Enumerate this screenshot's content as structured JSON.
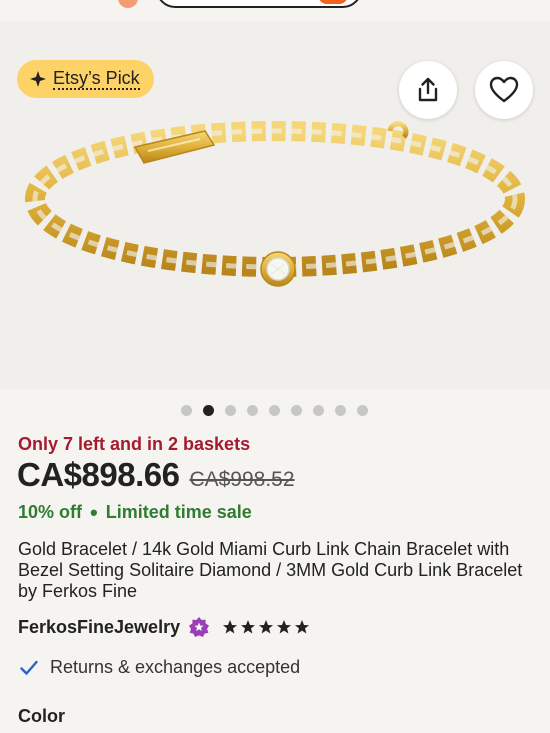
{
  "gallery": {
    "badge_label": "Etsy’s Pick",
    "image_count": 9,
    "active_index": 1
  },
  "listing": {
    "stock_text": "Only 7 left and in 2 baskets",
    "price": "CA$898.66",
    "original_price": "CA$998.52",
    "discount": "10% off",
    "sale_label": "Limited time sale",
    "title": "Gold Bracelet / 14k Gold Miami Curb Link Chain Bracelet with Bezel Setting Solitaire Diamond / 3MM Gold Curb Link Bracelet by Ferkos Fine",
    "shop_name": "FerkosFineJewelry",
    "rating": 5,
    "returns_text": "Returns & exchanges accepted",
    "color_label": "Color"
  },
  "colors": {
    "stock": "#a61a2e",
    "sale": "#2f7d32",
    "badge": "#fdd267",
    "star_seller": "#9a3fb5",
    "check": "#2a5fcf"
  }
}
